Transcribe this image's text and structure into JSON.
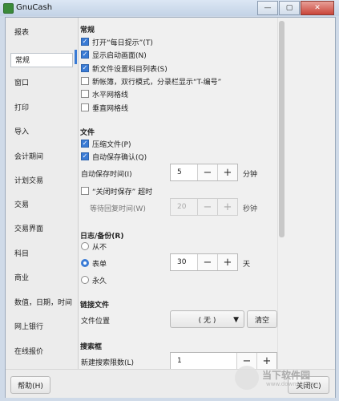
{
  "window": {
    "title": "GnuCash",
    "min_glyph": "—",
    "max_glyph": "▢",
    "close_glyph": "✕"
  },
  "sidebar": {
    "items": [
      {
        "label": "报表"
      },
      {
        "label": "常规"
      },
      {
        "label": "窗口"
      },
      {
        "label": "打印"
      },
      {
        "label": "导入"
      },
      {
        "label": "会计期间"
      },
      {
        "label": "计划交易"
      },
      {
        "label": "交易"
      },
      {
        "label": "交易界面"
      },
      {
        "label": "科目"
      },
      {
        "label": "商业"
      },
      {
        "label": "数值，日期，时间"
      },
      {
        "label": "网上银行"
      },
      {
        "label": "在线报价"
      }
    ]
  },
  "general": {
    "heading": "常规",
    "options": [
      {
        "label": "打开“每日提示”(T)",
        "checked": true
      },
      {
        "label": "显示启动画面(N)",
        "checked": true
      },
      {
        "label": "新文件设置科目列表(S)",
        "checked": true
      },
      {
        "label": "新帐簿，双行模式，分录栏显示“T-编号”",
        "checked": false
      },
      {
        "label": "水平网格线",
        "checked": false
      },
      {
        "label": "垂直网格线",
        "checked": false
      }
    ]
  },
  "files": {
    "heading": "文件",
    "compress": {
      "label": "压缩文件(P)",
      "checked": true
    },
    "autosave_confirm": {
      "label": "自动保存确认(Q)",
      "checked": true
    },
    "autosave_interval": {
      "label": "自动保存时间(I)",
      "value": "5",
      "unit": "分钟"
    },
    "close_save": {
      "label": "“关闭时保存”  超时",
      "checked": false
    },
    "wait_reply": {
      "label": "等待回复时间(W)",
      "value": "20",
      "unit": "秒钟"
    }
  },
  "log": {
    "heading": "日志/备份(R)",
    "options": [
      {
        "label": "从不",
        "checked": false
      },
      {
        "label": "表单",
        "checked": true
      },
      {
        "label": "永久",
        "checked": false
      }
    ],
    "days": {
      "value": "30",
      "unit": "天"
    }
  },
  "linked": {
    "heading": "链接文件",
    "location_label": "文件位置",
    "combo_value": "( 无 )",
    "clear_label": "清空"
  },
  "search": {
    "heading": "搜索框",
    "limit_label": "新建搜索限数(L)",
    "limit_value": "1"
  },
  "spin": {
    "minus": "−",
    "plus": "+"
  },
  "footer": {
    "help_label": "帮助(H)",
    "close_label": "关闭(C)"
  },
  "watermark": {
    "text": "当下软件园",
    "sub": "www.downxia.com"
  }
}
